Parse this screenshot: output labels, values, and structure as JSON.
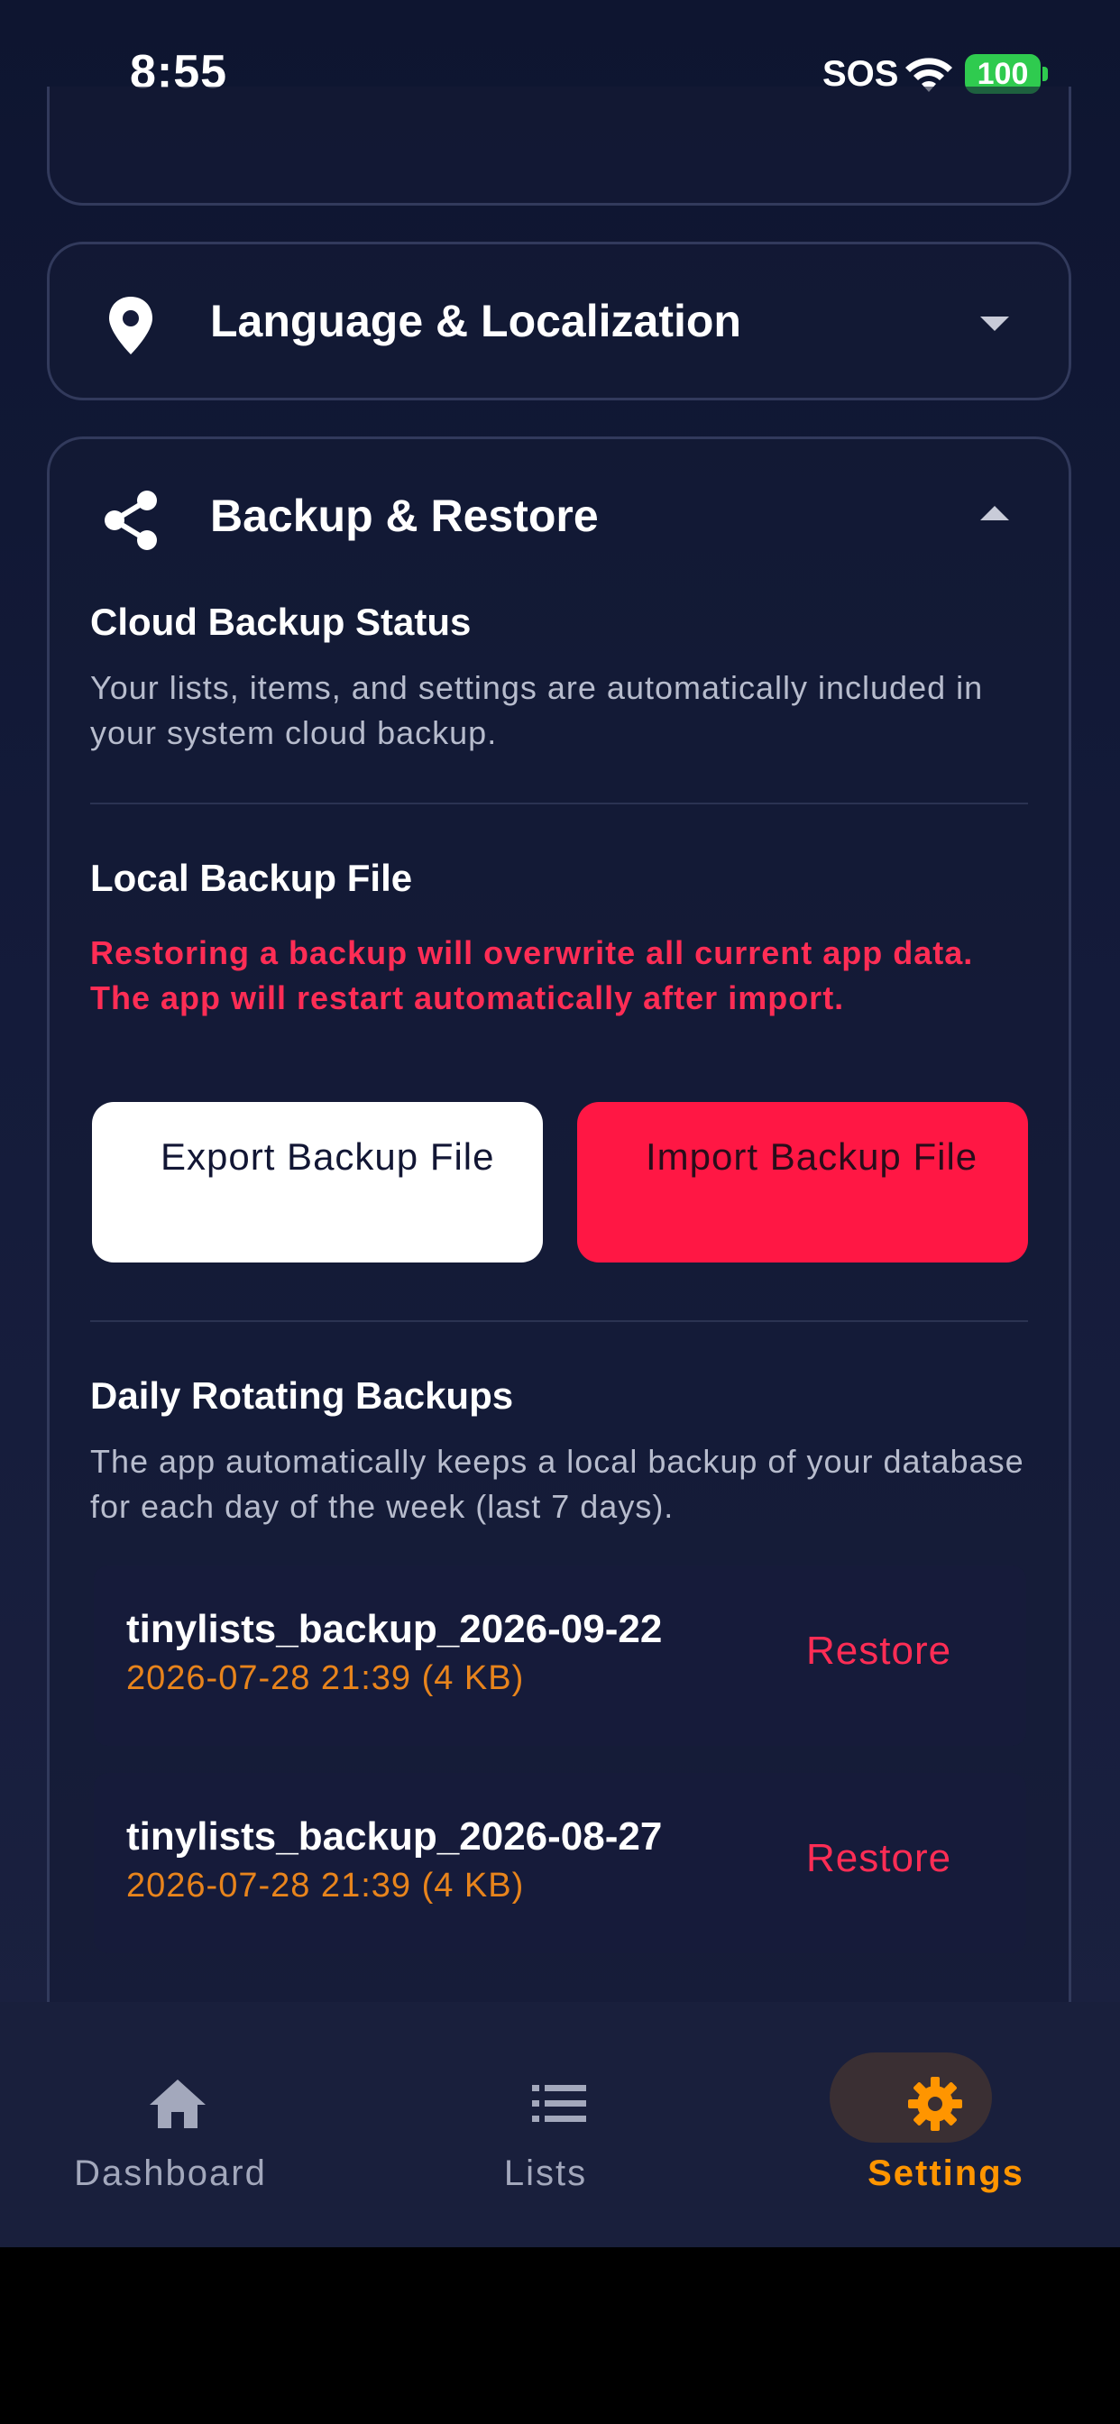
{
  "status_bar": {
    "time": "8:55",
    "sos": "SOS",
    "battery": "100"
  },
  "sections": {
    "language": {
      "title": "Language & Localization",
      "icon": "location-pin-icon"
    },
    "backup": {
      "title": "Backup & Restore",
      "icon": "share-icon",
      "cloud": {
        "heading": "Cloud Backup Status",
        "text": "Your lists, items, and settings are automatically included in your system cloud backup."
      },
      "local": {
        "heading": "Local Backup File",
        "warning": "Restoring a backup will overwrite all current app data. The app will restart automatically after import.",
        "export_label": "Export Backup File",
        "import_label": "Import Backup File"
      },
      "daily": {
        "heading": "Daily Rotating Backups",
        "text": "The app automatically keeps a local backup of your database for each day of the week (last 7 days).",
        "items": [
          {
            "name": "tinylists_backup_2026-09-22",
            "meta": "2026-07-28 21:39 (4 KB)",
            "action": "Restore"
          },
          {
            "name": "tinylists_backup_2026-08-27",
            "meta": "2026-07-28 21:39 (4 KB)",
            "action": "Restore"
          }
        ]
      }
    }
  },
  "tabs": [
    {
      "label": "Dashboard",
      "icon": "home-icon",
      "active": false
    },
    {
      "label": "Lists",
      "icon": "list-icon",
      "active": false
    },
    {
      "label": "Settings",
      "icon": "gear-icon",
      "active": true
    }
  ],
  "colors": {
    "accent": "#ff9500",
    "danger": "#ff1744",
    "meta": "#e8841c"
  }
}
